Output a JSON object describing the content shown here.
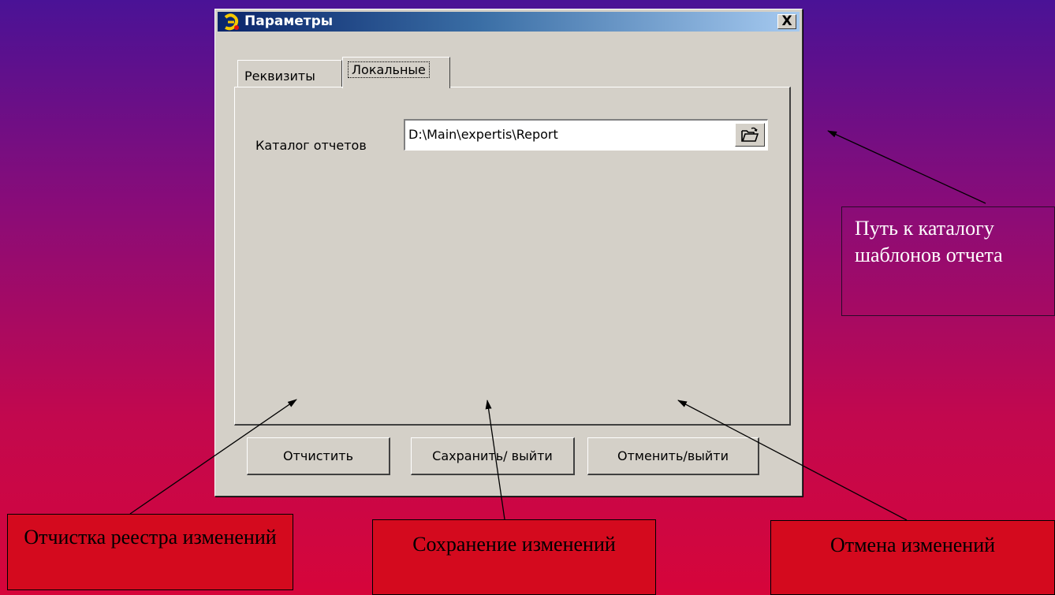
{
  "window": {
    "title": "Параметры",
    "close_label": "X"
  },
  "tabs": [
    {
      "label": "Реквизиты",
      "active": false
    },
    {
      "label": "Локальные",
      "active": true
    }
  ],
  "local": {
    "catalog_label": "Каталог отчетов",
    "catalog_path": "D:\\Main\\expertis\\Report"
  },
  "buttons": {
    "clear": "Отчистить",
    "save": "Сахранить/ выйти",
    "cancel": "Отменить/выйти"
  },
  "callouts": {
    "path": "Путь к каталогу шаблонов отчета",
    "clear": "Отчистка реестра изменений",
    "save": "Сохранение изменений",
    "cancel": "Отмена изменений"
  },
  "icons": {
    "app": "app-logo-icon",
    "browse": "open-folder-icon"
  },
  "colors": {
    "callout_bg": "#d40a1e",
    "titlebar_start": "#0a246a",
    "titlebar_end": "#a6caf0",
    "dialog_bg": "#d4d0c8"
  }
}
